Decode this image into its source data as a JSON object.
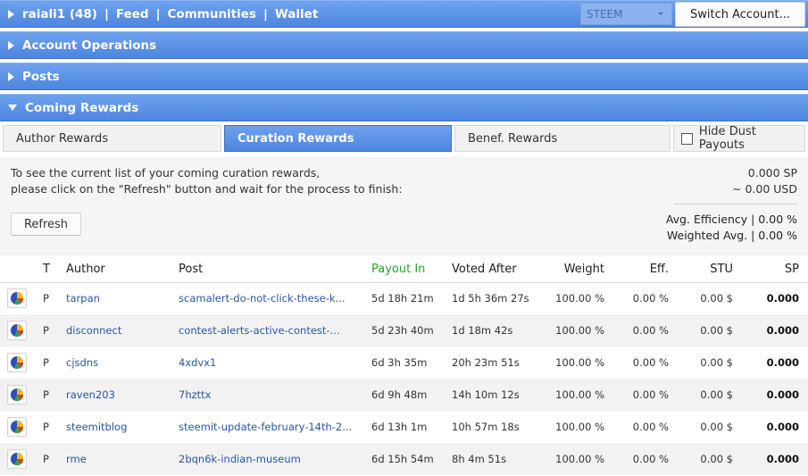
{
  "topnav": {
    "account": "raiali1 (48)",
    "feed": "Feed",
    "communities": "Communities",
    "wallet": "Wallet",
    "separator": "|",
    "currency": "STEEM",
    "switch_account": "Switch Account..."
  },
  "sections": {
    "account_operations": "Account Operations",
    "posts": "Posts",
    "coming_rewards": "Coming Rewards"
  },
  "tabs": {
    "author": "Author Rewards",
    "curation": "Curation Rewards",
    "benef": "Benef. Rewards",
    "hide_dust": "Hide Dust Payouts"
  },
  "info": {
    "line1": "To see the current list of your coming curation rewards,",
    "line2": "please click on the \"Refresh\" button and wait for the process to finish:",
    "refresh": "Refresh",
    "total_sp": "0.000 SP",
    "total_usd": "~ 0.00 USD",
    "avg_efficiency": "Avg. Efficiency | 0.00 %",
    "weighted_avg": "Weighted Avg. | 0.00 %"
  },
  "table": {
    "headers": {
      "t": "T",
      "author": "Author",
      "post": "Post",
      "payout_in": "Payout In",
      "voted_after": "Voted After",
      "weight": "Weight",
      "eff": "Eff.",
      "stu": "STU",
      "sp": "SP"
    },
    "rows": [
      {
        "t": "P",
        "author": "tarpan",
        "post": "scamalert-do-not-click-these-k...",
        "payout_in": "5d 18h 21m",
        "voted_after": "1d 5h 36m 27s",
        "weight": "100.00 %",
        "eff": "0.00 %",
        "stu": "0.00 $",
        "sp": "0.000"
      },
      {
        "t": "P",
        "author": "disconnect",
        "post": "contest-alerts-active-contest-...",
        "payout_in": "5d 23h 40m",
        "voted_after": "1d 18m 42s",
        "weight": "100.00 %",
        "eff": "0.00 %",
        "stu": "0.00 $",
        "sp": "0.000"
      },
      {
        "t": "P",
        "author": "cjsdns",
        "post": "4xdvx1",
        "payout_in": "6d 3h 35m",
        "voted_after": "20h 23m 51s",
        "weight": "100.00 %",
        "eff": "0.00 %",
        "stu": "0.00 $",
        "sp": "0.000"
      },
      {
        "t": "P",
        "author": "raven203",
        "post": "7hzttx",
        "payout_in": "6d 9h 48m",
        "voted_after": "14h 10m 12s",
        "weight": "100.00 %",
        "eff": "0.00 %",
        "stu": "0.00 $",
        "sp": "0.000"
      },
      {
        "t": "P",
        "author": "steemitblog",
        "post": "steemit-update-february-14th-2...",
        "payout_in": "6d 13h 1m",
        "voted_after": "10h 57m 18s",
        "weight": "100.00 %",
        "eff": "0.00 %",
        "stu": "0.00 $",
        "sp": "0.000"
      },
      {
        "t": "P",
        "author": "rme",
        "post": "2bqn6k-indian-museum",
        "payout_in": "6d 15h 54m",
        "voted_after": "8h 4m 51s",
        "weight": "100.00 %",
        "eff": "0.00 %",
        "stu": "0.00 $",
        "sp": "0.000"
      }
    ]
  }
}
